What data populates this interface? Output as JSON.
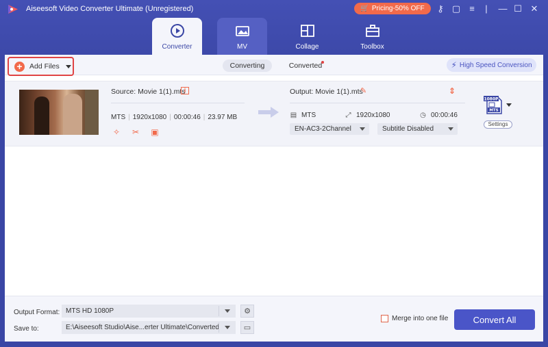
{
  "app": {
    "title": "Aiseesoft Video Converter Ultimate (Unregistered)"
  },
  "titlebar": {
    "pricing_label": "Pricing-50% OFF"
  },
  "tabs": [
    {
      "label": "Converter"
    },
    {
      "label": "MV"
    },
    {
      "label": "Collage"
    },
    {
      "label": "Toolbox"
    }
  ],
  "toolbar": {
    "add_files_label": "Add Files",
    "converting_label": "Converting",
    "converted_label": "Converted",
    "high_speed_label": "High Speed Conversion"
  },
  "file": {
    "source_label": "Source: Movie 1(1).mts",
    "format": "MTS",
    "resolution": "1920x1080",
    "duration": "00:00:46",
    "size": "23.97 MB",
    "output_label": "Output: Movie 1(1).mts",
    "out_format": "MTS",
    "out_resolution": "1920x1080",
    "out_duration": "00:00:46",
    "audio_track": "EN-AC3-2Channel",
    "subtitle": "Subtitle Disabled",
    "badge_top": "1080P",
    "badge_bottom": "MTS",
    "settings_label": "Settings"
  },
  "bottom": {
    "output_format_label": "Output Format:",
    "output_format_value": "MTS HD 1080P",
    "save_to_label": "Save to:",
    "save_to_value": "E:\\Aiseesoft Studio\\Aise...erter Ultimate\\Converted",
    "merge_label": "Merge into one file",
    "convert_all_label": "Convert All"
  },
  "colors": {
    "accent": "#4a55c8",
    "orange": "#f26a4b",
    "header": "#3a46a5"
  }
}
